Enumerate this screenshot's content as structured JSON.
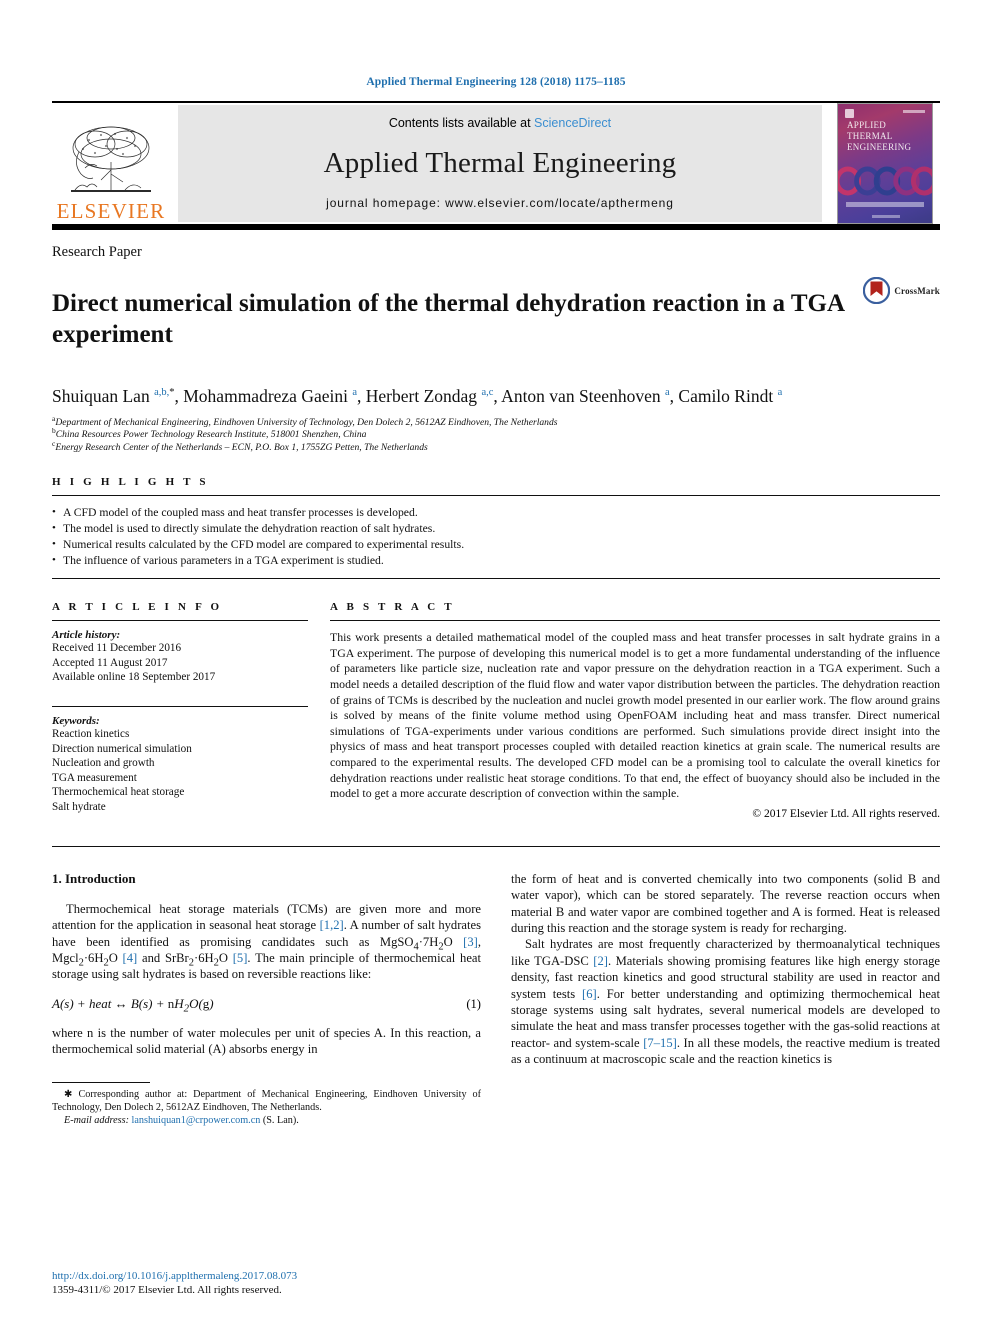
{
  "running_head": "Applied Thermal Engineering 128 (2018) 1175–1185",
  "masthead": {
    "publisher_name": "ELSEVIER",
    "contents_prefix": "Contents lists available at ",
    "contents_link": "ScienceDirect",
    "journal_name": "Applied Thermal Engineering",
    "homepage_line": "journal homepage: www.elsevier.com/locate/apthermeng",
    "cover_title_lines": [
      "APPLIED",
      "THERMAL",
      "ENGINEERING"
    ]
  },
  "article": {
    "section_type": "Research Paper",
    "title": "Direct numerical simulation of the thermal dehydration reaction in a TGA experiment",
    "crossmark_label": "CrossMark",
    "authors_html": "Shuiquan Lan <sup>a,b,</sup><sup class=\"blk\">*</sup>, Mohammadreza Gaeini <sup>a</sup>, Herbert Zondag <sup>a,c</sup>, Anton van Steenhoven <sup>a</sup>, Camilo Rindt <sup>a</sup>",
    "affiliations": [
      {
        "marker": "a",
        "text": "Department of Mechanical Engineering, Eindhoven University of Technology, Den Dolech 2, 5612AZ Eindhoven, The Netherlands"
      },
      {
        "marker": "b",
        "text": "China Resources Power Technology Research Institute, 518001 Shenzhen, China"
      },
      {
        "marker": "c",
        "text": "Energy Research Center of the Netherlands – ECN, P.O. Box 1, 1755ZG Petten, The Netherlands"
      }
    ]
  },
  "highlights": {
    "heading": "H I G H L I G H T S",
    "items": [
      "A CFD model of the coupled mass and heat transfer processes is developed.",
      "The model is used to directly simulate the dehydration reaction of salt hydrates.",
      "Numerical results calculated by the CFD model are compared to experimental results.",
      "The influence of various parameters in a TGA experiment is studied."
    ]
  },
  "article_info": {
    "heading": "A R T I C L E    I N F O",
    "history_label": "Article history:",
    "history": [
      "Received 11 December 2016",
      "Accepted 11 August 2017",
      "Available online 18 September 2017"
    ],
    "keywords_label": "Keywords:",
    "keywords": [
      "Reaction kinetics",
      "Direction numerical simulation",
      "Nucleation and growth",
      "TGA measurement",
      "Thermochemical heat storage",
      "Salt hydrate"
    ]
  },
  "abstract": {
    "heading": "A B S T R A C T",
    "text": "This work presents a detailed mathematical model of the coupled mass and heat transfer processes in salt hydrate grains in a TGA experiment. The purpose of developing this numerical model is to get a more fundamental understanding of the influence of parameters like particle size, nucleation rate and vapor pressure on the dehydration reaction in a TGA experiment. Such a model needs a detailed description of the fluid flow and water vapor distribution between the particles. The dehydration reaction of grains of TCMs is described by the nucleation and nuclei growth model presented in our earlier work. The flow around grains is solved by means of the finite volume method using OpenFOAM including heat and mass transfer. Direct numerical simulations of TGA-experiments under various conditions are performed. Such simulations provide direct insight into the physics of mass and heat transport processes coupled with detailed reaction kinetics at grain scale. The numerical results are compared to the experimental results. The developed CFD model can be a promising tool to calculate the overall kinetics for dehydration reactions under realistic heat storage conditions. To that end, the effect of buoyancy should also be included in the model to get a more accurate description of convection within the sample.",
    "copyright": "© 2017 Elsevier Ltd. All rights reserved."
  },
  "body": {
    "section_number_title": "1. Introduction",
    "left_paragraph_1_html": "Thermochemical heat storage materials (TCMs) are given more and more attention for the application in seasonal heat storage <span class=\"ref\">[1,2]</span>. A number of salt hydrates have been identified as promising candidates such as MgSO<sub>4</sub>&middot;7H<sub>2</sub>O <span class=\"ref\">[3]</span>, Mgcl<sub>2</sub>&middot;6H<sub>2</sub>O <span class=\"ref\">[4]</span> and SrBr<sub>2</sub>&middot;6H<sub>2</sub>O <span class=\"ref\">[5]</span>. The main principle of thermochemical heat storage using salt hydrates is based on reversible reactions like:",
    "equation_html": "A(s) + <i>heat</i> &harr; B(s) + <span class=\"up\">n</span>H<sub>2</sub>O(<span class=\"up\">g</span>)",
    "equation_number": "(1)",
    "left_paragraph_2_html": "where n is the number of water molecules per unit of species A. In this reaction, a thermochemical solid material (A) absorbs energy in",
    "right_paragraph_1_html": "the form of heat and is converted chemically into two components (solid B and water vapor), which can be stored separately. The reverse reaction occurs when material B and water vapor are combined together and A is formed. Heat is released during this reaction and the storage system is ready for recharging.",
    "right_paragraph_2_html": "Salt hydrates are most frequently characterized by thermoanalytical techniques like TGA-DSC <span class=\"ref\">[2]</span>. Materials showing promising features like high energy storage density, fast reaction kinetics and good structural stability are used in reactor and system tests <span class=\"ref\">[6]</span>. For better understanding and optimizing thermochemical heat storage systems using salt hydrates, several numerical models are developed to simulate the heat and mass transfer processes together with the gas-solid reactions at reactor- and system-scale <span class=\"ref\">[7–15]</span>. In all these models, the reactive medium is treated as a continuum at macroscopic scale and the reaction kinetics is"
  },
  "footnote": {
    "corresponding_html": "<span class=\"lead\">&#10033; Corresponding author at: Department of Mechanical Engineering, Eindhoven University of Technology, Den Dolech 2, 5612AZ Eindhoven, The Netherlands.</span>",
    "email_label": "E-mail address:",
    "email": "lanshuiquan1@crpower.com.cn",
    "email_owner": "(S. Lan)."
  },
  "footer": {
    "doi": "http://dx.doi.org/10.1016/j.applthermaleng.2017.08.073",
    "issn_line": "1359-4311/© 2017 Elsevier Ltd. All rights reserved."
  },
  "colors": {
    "link": "#1f6fae",
    "sciencedirect": "#3b8ed0",
    "elsevier_orange": "#e87722",
    "masthead_gray": "#e6e6e6"
  }
}
